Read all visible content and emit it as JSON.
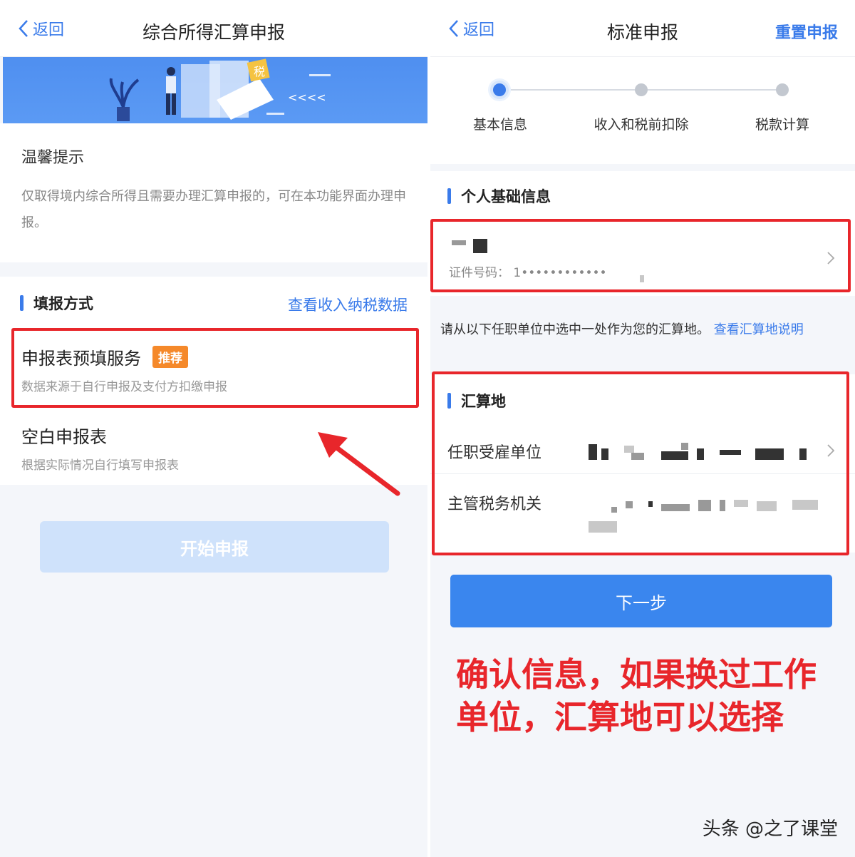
{
  "left": {
    "nav": {
      "back_label": "返回",
      "title": "综合所得汇算申报"
    },
    "banner": {
      "tax_badge": "税",
      "arrows": "<<<<"
    },
    "tip": {
      "title": "温馨提示",
      "text": "仅取得境内综合所得且需要办理汇算申报的，可在本功能界面办理申报。"
    },
    "method": {
      "section_title": "填报方式",
      "link": "查看收入纳税数据",
      "option1": {
        "title": "申报表预填服务",
        "badge": "推荐",
        "subtitle": "数据来源于自行申报及支付方扣缴申报"
      },
      "option2": {
        "title": "空白申报表",
        "subtitle": "根据实际情况自行填写申报表"
      }
    },
    "start_button": "开始申报"
  },
  "right": {
    "nav": {
      "back_label": "返回",
      "title": "标准申报",
      "reset": "重置申报"
    },
    "steps": [
      {
        "label": "基本信息",
        "active": true
      },
      {
        "label": "收入和税前扣除",
        "active": false
      },
      {
        "label": "税款计算",
        "active": false
      }
    ],
    "personal": {
      "section_title": "个人基础信息",
      "id_label": "证件号码：",
      "id_value": "1••••••••••••"
    },
    "notice": {
      "text": "请从以下任职单位中选中一处作为您的汇算地。",
      "link": "查看汇算地说明"
    },
    "settle": {
      "section_title": "汇算地",
      "employer_label": "任职受雇单位",
      "authority_label": "主管税务机关"
    },
    "next_button": "下一步",
    "annotation": "确认信息，如果换过工作单位，汇算地可以选择"
  },
  "watermark": "头条 @之了课堂",
  "colors": {
    "accent": "#3a7bea",
    "highlight": "#e8262b",
    "badge": "#f5892a"
  }
}
